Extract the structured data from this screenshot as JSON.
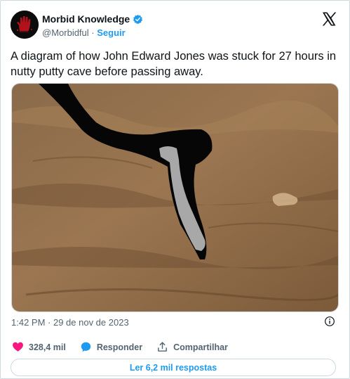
{
  "author": {
    "name": "Morbid Knowledge",
    "handle": "@Morbidful",
    "separator": "·",
    "follow_label": "Seguir"
  },
  "tweet": {
    "text": "A diagram of how John Edward Jones was stuck for 27 hours in nutty putty cave before passing away."
  },
  "meta": {
    "timestamp": "1:42 PM · 29 de nov de 2023"
  },
  "actions": {
    "like_count": "328,4 mil",
    "reply_label": "Responder",
    "share_label": "Compartilhar"
  },
  "replies_button": "Ler 6,2 mil respostas",
  "colors": {
    "accent": "#1d9bf0",
    "like": "#f91880",
    "secondary_text": "#536471",
    "border": "#cfd9de"
  }
}
